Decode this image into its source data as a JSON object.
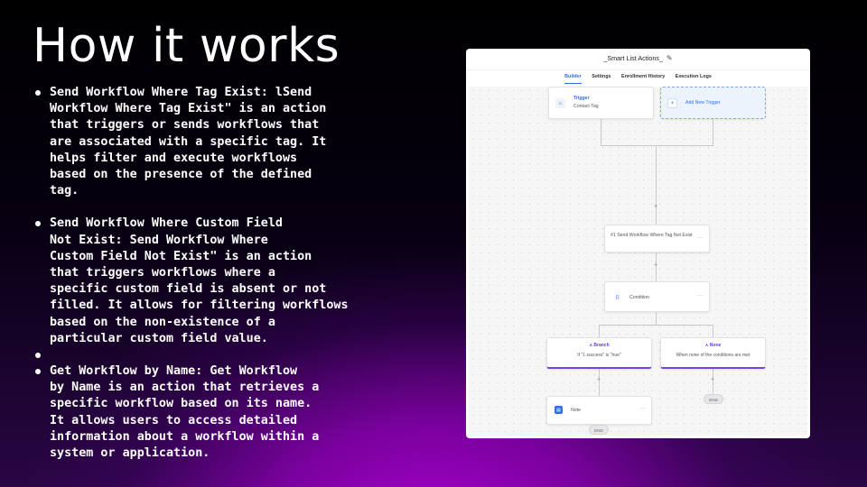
{
  "slide": {
    "title": "How it works",
    "bullets": [
      "Send Workflow Where Tag Exist: lSend\nWorkflow Where Tag Exist\" is an action\nthat triggers or sends workflows that\nare associated with a specific tag. It\nhelps filter and execute workflows\nbased on the presence of the defined\ntag.",
      "Send Workflow Where Custom Field\nNot Exist: Send Workflow Where\nCustom Field Not Exist\" is an action\nthat triggers workflows where a\nspecific custom field is absent or not\nfilled. It allows for filtering workflows\nbased on the non-existence of a\nparticular custom field value.",
      "",
      "Get Workflow by Name: Get Workflow\nby Name is an action that retrieves a\nspecific workflow based on its name.\nIt allows users to access detailed\ninformation about a workflow within a\nsystem or application."
    ]
  },
  "screenshot": {
    "workflow_title": "_Smart List Actions_",
    "tabs": [
      "Builder",
      "Settings",
      "Enrollment History",
      "Execution Logs"
    ],
    "active_tab": "Builder",
    "trigger": {
      "label": "Trigger",
      "value": "Contact Tag"
    },
    "add_trigger": "Add New Trigger",
    "action_step": "#1 Send Workflow Where Tag Not Exist",
    "condition": "Condition",
    "branch": {
      "title": "Branch",
      "desc": "If \"1 success\" is \"true\""
    },
    "none_branch": {
      "title": "None",
      "desc": "When none of the conditions are met"
    },
    "note": "Note",
    "end_label": "END",
    "more_glyph": "···",
    "plus_glyph": "+",
    "colors": {
      "accent": "#2f6fe4",
      "branch": "#7b3ee0"
    }
  }
}
